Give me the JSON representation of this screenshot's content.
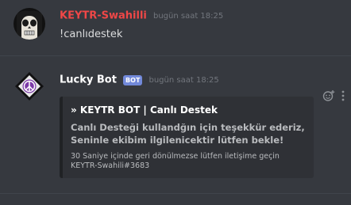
{
  "messages": [
    {
      "username": "KEYTR-Swahilli",
      "username_color": "#f04747",
      "timestamp": "bugün saat 18:25",
      "content": "!canlıdestek",
      "avatar_icon": "skull-face-avatar"
    },
    {
      "username": "Lucky Bot",
      "username_color": "#ffffff",
      "bot_tag": "BOT",
      "timestamp": "bugün saat 18:25",
      "avatar_icon": "peace-sign-avatar",
      "embed": {
        "title": "» KEYTR BOT | Canlı Destek",
        "description_line1": "Canlı Desteği kullandğın için teşekkür ederiz,",
        "description_line2": "Seninle ekibim ilgilenicektir lütfen bekle!",
        "footer_line1": "30 Saniye içinde geri dönülmezse lütfen iletişime geçin",
        "footer_line2": "KEYTR-Swahili#3683"
      }
    }
  ],
  "colors": {
    "background": "#36393f",
    "embed_background": "#2f3136",
    "timestamp": "#72767d",
    "bot_tag": "#7289da"
  },
  "icons": {
    "reaction": "add-reaction-icon",
    "more": "more-options-icon"
  }
}
